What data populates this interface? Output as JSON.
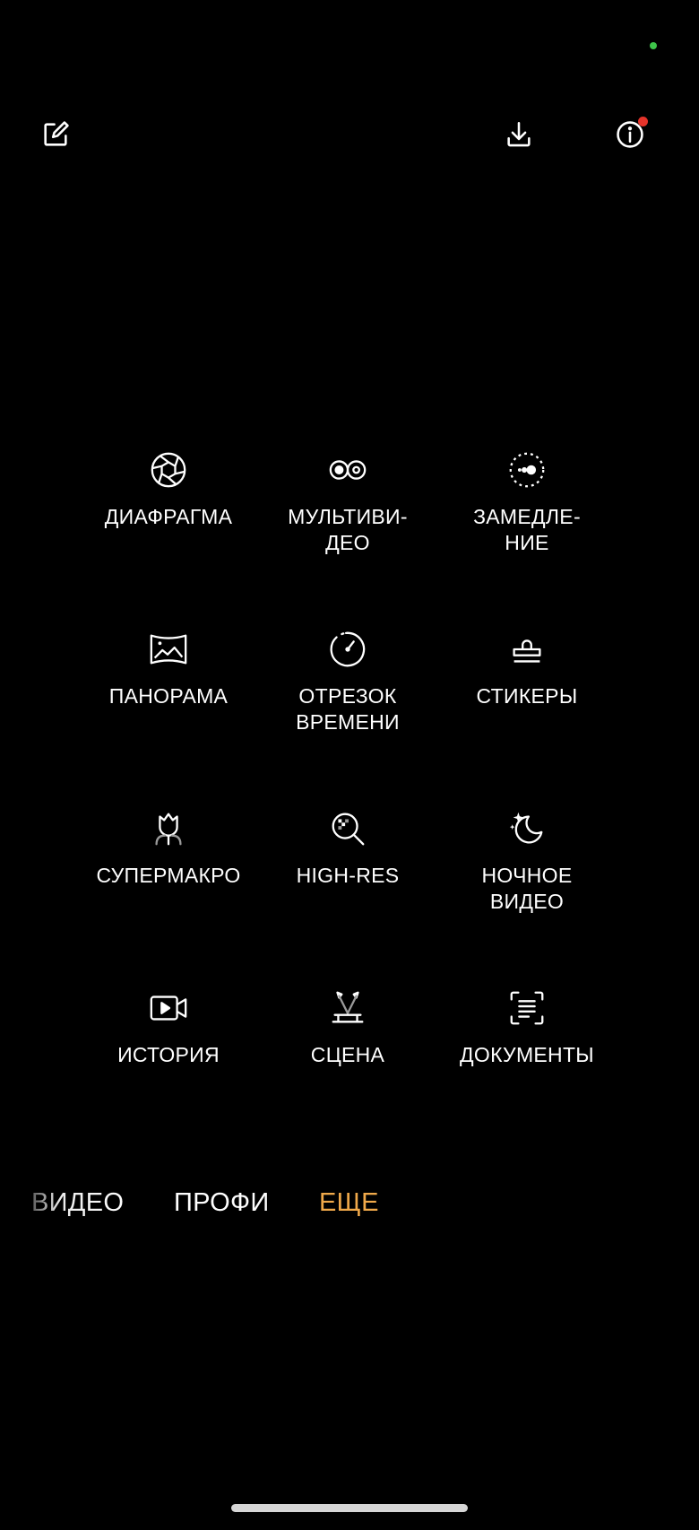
{
  "colors": {
    "background": "#000000",
    "text": "#ffffff",
    "accent": "#f0a94a",
    "notification": "#e5332a",
    "camera_indicator": "#3ec44a"
  },
  "top_bar": {
    "edit_icon": "edit-icon",
    "download_icon": "download-icon",
    "info_icon": "info-icon"
  },
  "modes": [
    {
      "icon": "aperture-icon",
      "label": "ДИАФРАГМА"
    },
    {
      "icon": "multi-video-icon",
      "label": "МУЛЬТИВИ-\nДЕО"
    },
    {
      "icon": "slow-motion-icon",
      "label": "ЗАМЕДЛЕ-\nНИЕ"
    },
    {
      "icon": "panorama-icon",
      "label": "ПАНОРАМА"
    },
    {
      "icon": "timer-icon",
      "label": "ОТРЕЗОК\nВРЕМЕНИ"
    },
    {
      "icon": "stamp-icon",
      "label": "СТИКЕРЫ"
    },
    {
      "icon": "flower-icon",
      "label": "СУПЕРМАКРО"
    },
    {
      "icon": "zoom-search-icon",
      "label": "HIGH-RES"
    },
    {
      "icon": "moon-icon",
      "label": "НОЧНОЕ\nВИДЕО"
    },
    {
      "icon": "video-story-icon",
      "label": "ИСТОРИЯ"
    },
    {
      "icon": "stage-light-icon",
      "label": "СЦЕНА"
    },
    {
      "icon": "document-scan-icon",
      "label": "ДОКУМЕНТЫ"
    }
  ],
  "tabs": [
    {
      "label": "ВИДЕО",
      "active": false
    },
    {
      "label": "ПРОФИ",
      "active": false
    },
    {
      "label": "ЕЩЕ",
      "active": true
    }
  ]
}
